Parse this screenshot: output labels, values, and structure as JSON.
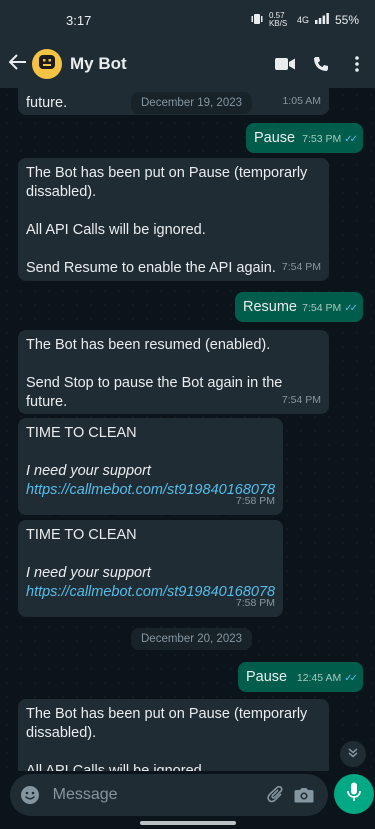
{
  "status_bar": {
    "time": "3:17",
    "net_speed": "0.57 KB/S",
    "network": "4G",
    "battery": "55%"
  },
  "header": {
    "back_icon": "back-arrow-icon",
    "title": "My Bot",
    "avatar_icon": "robot-face-icon"
  },
  "chat": {
    "partial_top": {
      "text": "future.",
      "time": "1:05 AM"
    },
    "date_1": "December 19, 2023",
    "pause_1": {
      "text": "Pause",
      "time": "7:53 PM"
    },
    "paused_msg_1": {
      "line1": "The Bot has been put on Pause (temporarly dissabled).",
      "line2": "All API Calls will be ignored.",
      "line3": "Send Resume to enable the API again.",
      "time": "7:54 PM"
    },
    "resume": {
      "text": "Resume",
      "time": "7:54 PM"
    },
    "resumed_msg": {
      "line1": "The Bot has been resumed (enabled).",
      "line2": "Send Stop to pause the Bot again in the future.",
      "time": "7:54 PM"
    },
    "clean_1": {
      "title": "TIME TO CLEAN",
      "subtitle": "I need your support",
      "link": "https://callmebot.com/st919840168078",
      "time": "7:58 PM"
    },
    "clean_2": {
      "title": "TIME TO CLEAN",
      "subtitle": "I need your support",
      "link": "https://callmebot.com/st919840168078",
      "time": "7:58 PM"
    },
    "date_2": "December 20, 2023",
    "pause_2": {
      "text": "Pause",
      "time": "12:45 AM"
    },
    "paused_msg_2": {
      "line1": "The Bot has been put on Pause (temporarly dissabled).",
      "line2": "All API Calls will be ignored."
    }
  },
  "composer": {
    "placeholder": "Message"
  },
  "colors": {
    "accent": "#00a884",
    "outgoing_bubble": "#005c4b",
    "incoming_bubble": "#202c33",
    "link": "#53bdeb"
  }
}
